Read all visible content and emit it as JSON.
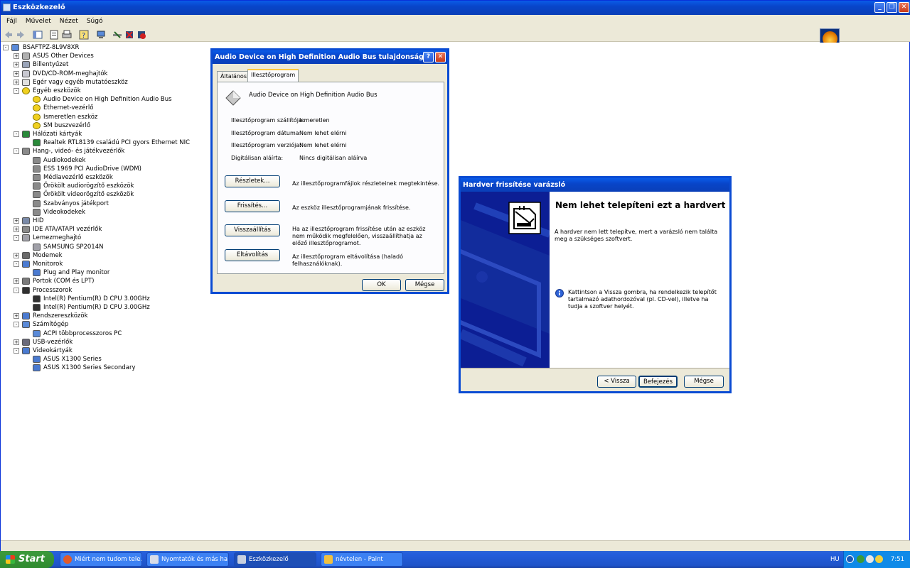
{
  "window": {
    "title": "Eszközkezelő"
  },
  "menu": [
    "Fájl",
    "Művelet",
    "Nézet",
    "Súgó"
  ],
  "tree": [
    {
      "label": "BSAFTPZ-8L9V8XR",
      "level": 0,
      "expander": "-",
      "icon": "computer-icon"
    },
    {
      "label": "ASUS Other Devices",
      "level": 1,
      "expander": "+",
      "icon": "device-icon"
    },
    {
      "label": "Billentyűzet",
      "level": 1,
      "expander": "+",
      "icon": "keyboard-icon"
    },
    {
      "label": "DVD/CD-ROM-meghajtók",
      "level": 1,
      "expander": "+",
      "icon": "cdrom-icon"
    },
    {
      "label": "Egér vagy egyéb mutatóeszköz",
      "level": 1,
      "expander": "+",
      "icon": "mouse-icon"
    },
    {
      "label": "Egyéb eszközök",
      "level": 1,
      "expander": "-",
      "icon": "unknown-device-icon"
    },
    {
      "label": "Audio Device on High Definition Audio Bus",
      "level": 2,
      "expander": "",
      "icon": "unknown-device-icon"
    },
    {
      "label": "Ethernet-vezérlő",
      "level": 2,
      "expander": "",
      "icon": "unknown-device-icon"
    },
    {
      "label": "Ismeretlen eszköz",
      "level": 2,
      "expander": "",
      "icon": "unknown-device-icon"
    },
    {
      "label": "SM buszvezérlő",
      "level": 2,
      "expander": "",
      "icon": "unknown-device-icon"
    },
    {
      "label": "Hálózati kártyák",
      "level": 1,
      "expander": "-",
      "icon": "network-card-icon"
    },
    {
      "label": "Realtek RTL8139 családú PCI gyors Ethernet NIC",
      "level": 2,
      "expander": "",
      "icon": "network-card-icon"
    },
    {
      "label": "Hang-, videó- és játékvezérlők",
      "level": 1,
      "expander": "-",
      "icon": "sound-icon"
    },
    {
      "label": "Audiokodekek",
      "level": 2,
      "expander": "",
      "icon": "sound-icon"
    },
    {
      "label": "ESS 1969 PCI AudioDrive (WDM)",
      "level": 2,
      "expander": "",
      "icon": "sound-icon"
    },
    {
      "label": "Médiavezérlő eszközök",
      "level": 2,
      "expander": "",
      "icon": "sound-icon"
    },
    {
      "label": "Örökölt audiorögzítő eszközök",
      "level": 2,
      "expander": "",
      "icon": "sound-icon"
    },
    {
      "label": "Örökölt videorögzítő eszközök",
      "level": 2,
      "expander": "",
      "icon": "sound-icon"
    },
    {
      "label": "Szabványos játékport",
      "level": 2,
      "expander": "",
      "icon": "sound-icon"
    },
    {
      "label": "Videokodekek",
      "level": 2,
      "expander": "",
      "icon": "sound-icon"
    },
    {
      "label": "HID",
      "level": 1,
      "expander": "+",
      "icon": "hid-icon"
    },
    {
      "label": "IDE ATA/ATAPI vezérlők",
      "level": 1,
      "expander": "+",
      "icon": "ide-icon"
    },
    {
      "label": "Lemezmeghajtó",
      "level": 1,
      "expander": "-",
      "icon": "disk-icon"
    },
    {
      "label": "SAMSUNG SP2014N",
      "level": 2,
      "expander": "",
      "icon": "disk-icon"
    },
    {
      "label": "Modemek",
      "level": 1,
      "expander": "+",
      "icon": "modem-icon"
    },
    {
      "label": "Monitorok",
      "level": 1,
      "expander": "-",
      "icon": "monitor-icon"
    },
    {
      "label": "Plug and Play monitor",
      "level": 2,
      "expander": "",
      "icon": "monitor-icon"
    },
    {
      "label": "Portok (COM és LPT)",
      "level": 1,
      "expander": "+",
      "icon": "port-icon"
    },
    {
      "label": "Processzorok",
      "level": 1,
      "expander": "-",
      "icon": "processor-icon"
    },
    {
      "label": "Intel(R) Pentium(R) D CPU 3.00GHz",
      "level": 2,
      "expander": "",
      "icon": "processor-icon"
    },
    {
      "label": "Intel(R) Pentium(R) D CPU 3.00GHz",
      "level": 2,
      "expander": "",
      "icon": "processor-icon"
    },
    {
      "label": "Rendszereszközök",
      "level": 1,
      "expander": "+",
      "icon": "system-device-icon"
    },
    {
      "label": "Számítógép",
      "level": 1,
      "expander": "-",
      "icon": "computer-icon"
    },
    {
      "label": "ACPI többprocesszoros PC",
      "level": 2,
      "expander": "",
      "icon": "computer-icon"
    },
    {
      "label": "USB-vezérlők",
      "level": 1,
      "expander": "+",
      "icon": "usb-icon"
    },
    {
      "label": "Videokártyák",
      "level": 1,
      "expander": "-",
      "icon": "display-adapter-icon"
    },
    {
      "label": "ASUS X1300 Series",
      "level": 2,
      "expander": "",
      "icon": "display-adapter-icon"
    },
    {
      "label": "ASUS X1300 Series Secondary",
      "level": 2,
      "expander": "",
      "icon": "display-adapter-icon"
    }
  ],
  "props_dialog": {
    "title": "Audio Device on High Definition Audio Bus tulajdonságai",
    "tabs": [
      "Általános",
      "Illesztőprogram"
    ],
    "device_name": "Audio Device on High Definition Audio Bus",
    "fields": [
      {
        "label": "Illesztőprogram szállítója:",
        "value": "Ismeretlen"
      },
      {
        "label": "Illesztőprogram dátuma:",
        "value": "Nem lehet elérni"
      },
      {
        "label": "Illesztőprogram verziója:",
        "value": "Nem lehet elérni"
      },
      {
        "label": "Digitálisan aláírta:",
        "value": "Nincs digitálisan aláírva"
      }
    ],
    "actions": [
      {
        "button": "Részletek...",
        "desc": "Az illesztőprogramfájlok részleteinek megtekintése."
      },
      {
        "button": "Frissítés...",
        "desc": "Az eszköz illesztőprogramjának frissítése."
      },
      {
        "button": "Visszaállítás",
        "desc": "Ha az illesztőprogram frissítése után az eszköz nem működik megfelelően, visszaállíthatja az előző illesztőprogramot."
      },
      {
        "button": "Eltávolítás",
        "desc": "Az illesztőprogram eltávolítása (haladó felhasználóknak)."
      }
    ],
    "ok": "OK",
    "cancel": "Mégse"
  },
  "wizard": {
    "title": "Hardver frissítése varázsló",
    "heading": "Nem lehet telepíteni ezt a hardvert",
    "message": "A hardver nem lett telepítve, mert a varázsló nem találta meg a szükséges szoftvert.",
    "info": "Kattintson a Vissza gombra, ha rendelkezik telepítőt tartalmazó adathordozóval (pl. CD-vel), illetve ha tudja a szoftver helyét.",
    "back": "< Vissza",
    "finish": "Befejezés",
    "cancel": "Mégse"
  },
  "taskbar": {
    "start": "Start",
    "tasks": [
      "Miért nem tudom tele...",
      "Nyomtatók és más ha...",
      "Eszközkezelő",
      "névtelen - Paint"
    ],
    "lang": "HU",
    "clock": "7:51"
  }
}
